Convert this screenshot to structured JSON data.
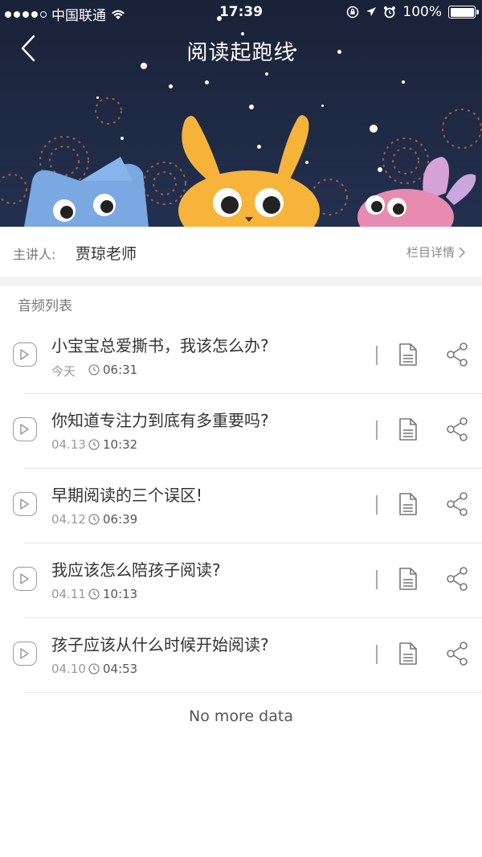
{
  "status_bar": {
    "carrier": "中国联通",
    "time": "17:39",
    "battery": "100%"
  },
  "nav": {
    "title": "阅读起跑线"
  },
  "host": {
    "label": "主讲人:",
    "name": "贾琼老师",
    "detail_link": "栏目详情"
  },
  "section": {
    "title": "音频列表"
  },
  "audio_items": [
    {
      "title": "小宝宝总爱撕书，我该怎么办?",
      "date": "今天",
      "duration": "06:31"
    },
    {
      "title": "你知道专注力到底有多重要吗?",
      "date": "04.13",
      "duration": "10:32"
    },
    {
      "title": "早期阅读的三个误区!",
      "date": "04.12",
      "duration": "06:39"
    },
    {
      "title": "我应该怎么陪孩子阅读?",
      "date": "04.11",
      "duration": "10:13"
    },
    {
      "title": "孩子应该从什么时候开始阅读?",
      "date": "04.10",
      "duration": "04:53"
    }
  ],
  "footer": {
    "no_more": "No more data"
  },
  "colors": {
    "hero_bg": "#1f2a44",
    "cat_blue": "#7aa8e0",
    "bunny_yellow": "#f6b33a",
    "bunny_pink": "#e88bb0"
  }
}
